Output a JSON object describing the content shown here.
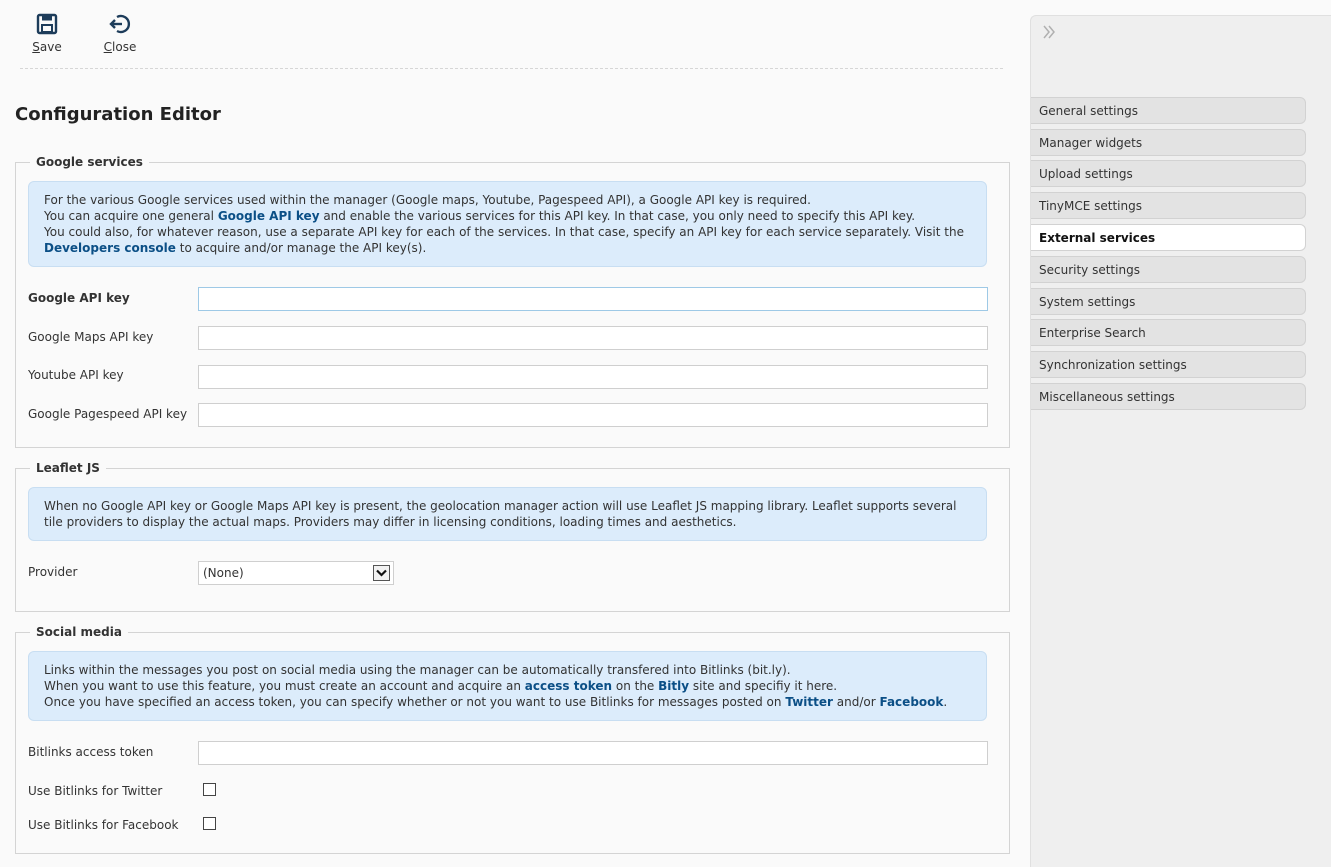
{
  "toolbar": {
    "save_label": "Save",
    "close_label": "Close"
  },
  "page_title": "Configuration Editor",
  "google": {
    "legend": "Google services",
    "info": {
      "l1": "For the various Google services used within the manager (Google maps, Youtube, Pagespeed API), a Google API key is required.",
      "l2a": "You can acquire one general ",
      "l2_link": "Google API key",
      "l2b": " and enable the various services for this API key. In that case, you only need to specify this API key.",
      "l3a": "You could also, for whatever reason, use a separate API key for each of the services. In that case, specify an API key for each service separately. Visit the ",
      "l3_link": "Developers console",
      "l3b": " to acquire and/or manage the API key(s)."
    },
    "fields": {
      "api_key_label": "Google API key",
      "maps_label": "Google Maps API key",
      "youtube_label": "Youtube API key",
      "pagespeed_label": "Google Pagespeed API key",
      "api_key_value": "",
      "maps_value": "",
      "youtube_value": "",
      "pagespeed_value": ""
    }
  },
  "leaflet": {
    "legend": "Leaflet JS",
    "info": "When no Google API key or Google Maps API key is present, the geolocation manager action will use Leaflet JS mapping library. Leaflet supports several tile providers to display the actual maps. Providers may differ in licensing conditions, loading times and aesthetics.",
    "provider_label": "Provider",
    "provider_value": "(None)"
  },
  "social": {
    "legend": "Social media",
    "info": {
      "l1": "Links within the messages you post on social media using the manager can be automatically transfered into Bitlinks (bit.ly).",
      "l2a": "When you want to use this feature, you must create an account and acquire an ",
      "l2_link1": "access token",
      "l2b": " on the ",
      "l2_link2": "Bitly",
      "l2c": " site and specifiy it here.",
      "l3a": "Once you have specified an access token, you can specify whether or not you want to use Bitlinks for messages posted on ",
      "l3_link1": "Twitter",
      "l3b": " and/or ",
      "l3_link2": "Facebook",
      "l3c": "."
    },
    "token_label": "Bitlinks access token",
    "token_value": "",
    "twitter_label": "Use Bitlinks for Twitter",
    "facebook_label": "Use Bitlinks for Facebook"
  },
  "sidebar": {
    "items": [
      {
        "label": "General settings"
      },
      {
        "label": "Manager widgets"
      },
      {
        "label": "Upload settings"
      },
      {
        "label": "TinyMCE settings"
      },
      {
        "label": "External services"
      },
      {
        "label": "Security settings"
      },
      {
        "label": "System settings"
      },
      {
        "label": "Enterprise Search"
      },
      {
        "label": "Synchronization settings"
      },
      {
        "label": "Miscellaneous settings"
      }
    ],
    "active_index": 4
  },
  "colors": {
    "accent_link": "#0b4f86",
    "info_bg": "#dcecfb",
    "icon": "#1d3c5a"
  }
}
